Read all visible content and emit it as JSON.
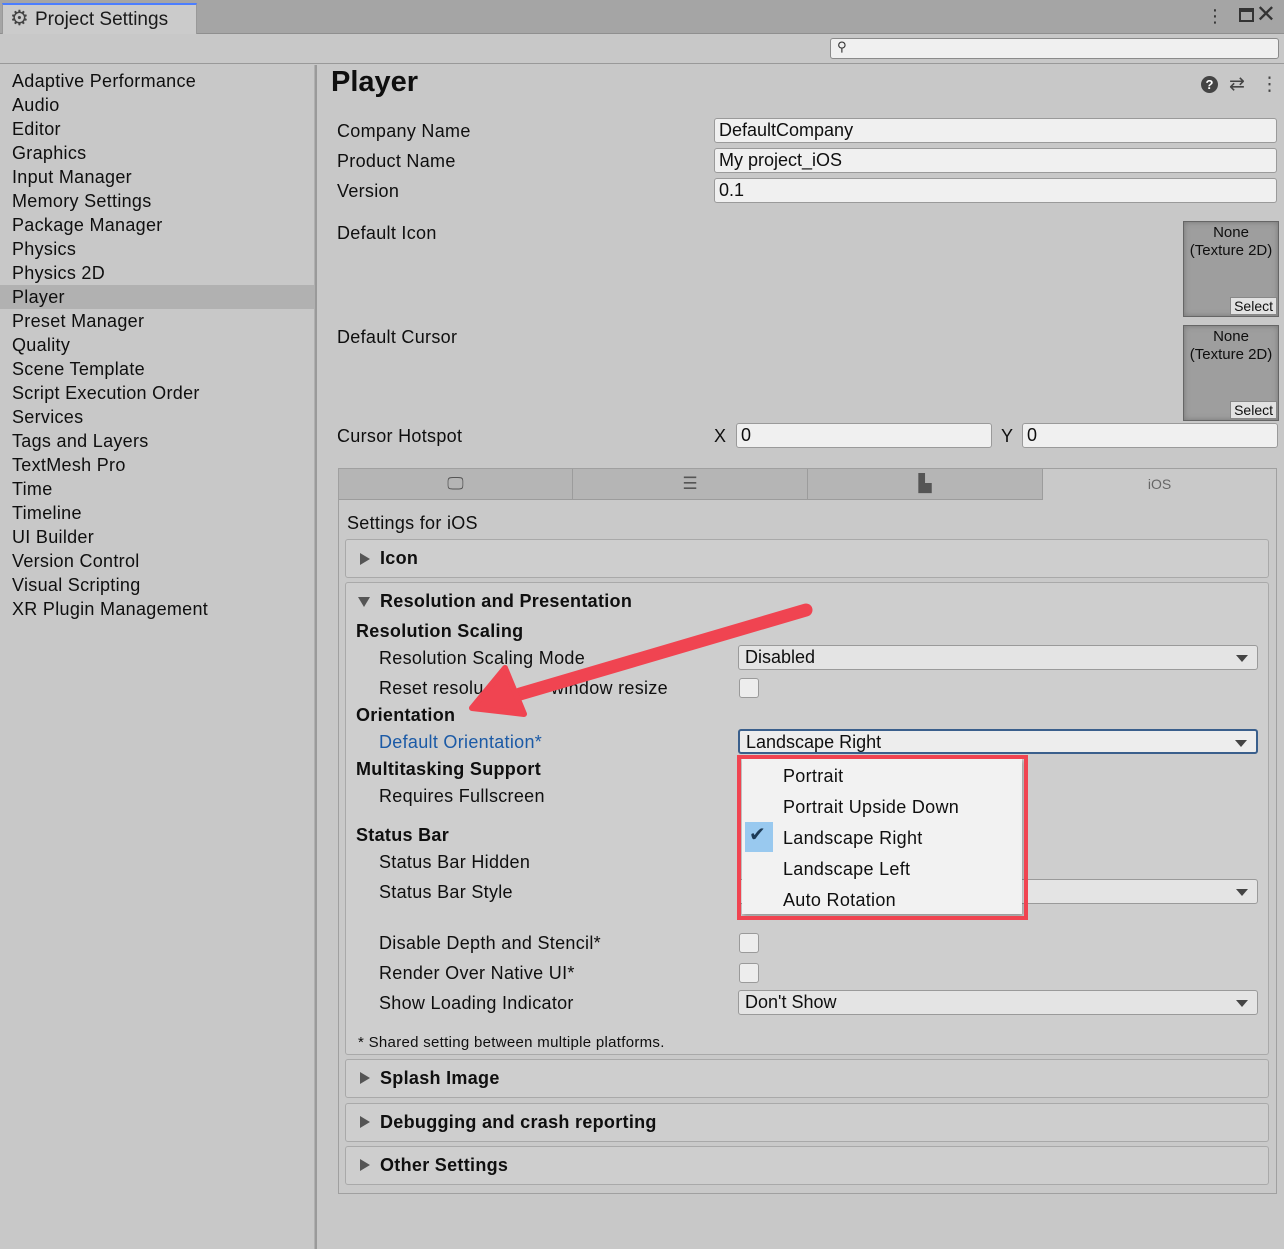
{
  "window": {
    "tab_title": "Project Settings",
    "search_placeholder": ""
  },
  "sidebar": {
    "items": [
      {
        "label": "Adaptive Performance"
      },
      {
        "label": "Audio"
      },
      {
        "label": "Editor"
      },
      {
        "label": "Graphics"
      },
      {
        "label": "Input Manager"
      },
      {
        "label": "Memory Settings"
      },
      {
        "label": "Package Manager"
      },
      {
        "label": "Physics"
      },
      {
        "label": "Physics 2D"
      },
      {
        "label": "Player",
        "selected": true
      },
      {
        "label": "Preset Manager"
      },
      {
        "label": "Quality"
      },
      {
        "label": "Scene Template"
      },
      {
        "label": "Script Execution Order"
      },
      {
        "label": "Services"
      },
      {
        "label": "Tags and Layers"
      },
      {
        "label": "TextMesh Pro"
      },
      {
        "label": "Time"
      },
      {
        "label": "Timeline"
      },
      {
        "label": "UI Builder"
      },
      {
        "label": "Version Control"
      },
      {
        "label": "Visual Scripting"
      },
      {
        "label": "XR Plugin Management"
      }
    ]
  },
  "player": {
    "title": "Player",
    "company_label": "Company Name",
    "company_value": "DefaultCompany",
    "product_label": "Product Name",
    "product_value": "My project_iOS",
    "version_label": "Version",
    "version_value": "0.1",
    "icon_label": "Default Icon",
    "cursor_label": "Default Cursor",
    "texture_none": "None",
    "texture_type": "(Texture 2D)",
    "select_label": "Select",
    "hotspot_label": "Cursor Hotspot",
    "hotspot_x_label": "X",
    "hotspot_x": "0",
    "hotspot_y_label": "Y",
    "hotspot_y": "0"
  },
  "platform_tabs": {
    "ios_label": "iOS",
    "active": "iOS"
  },
  "ios": {
    "settings_for": "Settings for iOS",
    "icon_section": "Icon",
    "resolution_section": "Resolution and Presentation",
    "resolution_scaling": "Resolution Scaling",
    "scaling_mode_label": "Resolution Scaling Mode",
    "scaling_mode_value": "Disabled",
    "reset_res_label_a": "Reset resolu",
    "reset_res_label_b": "window resize",
    "orientation": "Orientation",
    "default_orientation_label": "Default Orientation*",
    "default_orientation_value": "Landscape Right",
    "multitasking": "Multitasking Support",
    "requires_fullscreen": "Requires Fullscreen",
    "status_bar": "Status Bar",
    "status_bar_hidden": "Status Bar Hidden",
    "status_bar_style": "Status Bar Style",
    "disable_depth": "Disable Depth and Stencil*",
    "render_over": "Render Over Native UI*",
    "show_loading": "Show Loading Indicator",
    "show_loading_value": "Don't Show",
    "shared_note": "* Shared setting between multiple platforms.",
    "splash_section": "Splash Image",
    "debug_section": "Debugging and crash reporting",
    "other_section": "Other Settings"
  },
  "orientation_menu": {
    "options": [
      "Portrait",
      "Portrait Upside Down",
      "Landscape Right",
      "Landscape Left",
      "Auto Rotation"
    ],
    "selected": "Landscape Right"
  },
  "colors": {
    "annotation_red": "#f04451",
    "selection_blue": "#99c9ef",
    "modified_label_blue": "#1b5aa6"
  },
  "icons": [
    "gear-icon",
    "kebab-menu-icon",
    "maximize-icon",
    "close-icon",
    "search-icon",
    "help-icon",
    "preset-icon",
    "standalone-monitor-icon",
    "server-icon",
    "android-icon",
    "checkmark-icon"
  ]
}
